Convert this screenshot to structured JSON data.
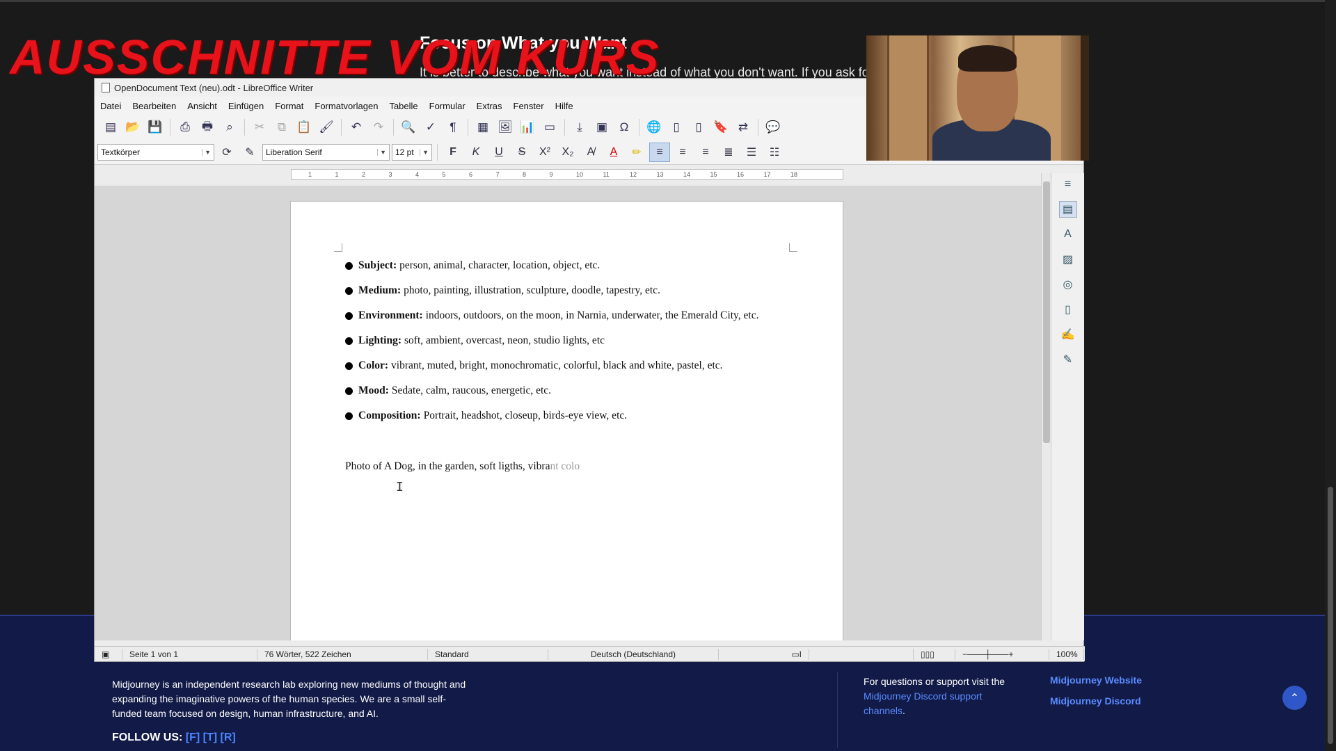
{
  "background_page": {
    "heading": "Focus on What you Want",
    "subtext": "It is better to describe what you want instead of what you don't want. If you ask for a pa"
  },
  "overlay": {
    "banner": "AUSSCHNITTE VOM KURS"
  },
  "writer": {
    "title": "OpenDocument Text (neu).odt - LibreOffice Writer",
    "menu": [
      "Datei",
      "Bearbeiten",
      "Ansicht",
      "Einfügen",
      "Format",
      "Formatvorlagen",
      "Tabelle",
      "Formular",
      "Extras",
      "Fenster",
      "Hilfe"
    ],
    "paragraph_style": "Textkörper",
    "font_name": "Liberation Serif",
    "font_size": "12 pt",
    "ruler_numbers": [
      "1",
      "1",
      "2",
      "3",
      "4",
      "5",
      "6",
      "7",
      "8",
      "9",
      "10",
      "11",
      "12",
      "13",
      "14",
      "15",
      "16",
      "17",
      "18"
    ],
    "bullets": [
      {
        "label": "Subject:",
        "text": "person, animal, character, location, object, etc."
      },
      {
        "label": "Medium:",
        "text": "photo, painting, illustration, sculpture, doodle, tapestry, etc."
      },
      {
        "label": "Environment:",
        "text": "indoors, outdoors, on the moon, in Narnia, underwater, the Emerald City, etc."
      },
      {
        "label": "Lighting:",
        "text": "soft, ambient, overcast, neon, studio lights, etc"
      },
      {
        "label": "Color:",
        "text": "vibrant, muted, bright, monochromatic, colorful, black and white, pastel, etc."
      },
      {
        "label": "Mood:",
        "text": "Sedate, calm, raucous, energetic, etc."
      },
      {
        "label": "Composition:",
        "text": "Portrait, headshot, closeup, birds-eye view, etc."
      }
    ],
    "prompt_typed": "Photo of A Dog, in the garden, soft ligths, vibra",
    "prompt_suggestion": "nt colo",
    "status": {
      "page": "Seite 1 von 1",
      "words": "76 Wörter, 522 Zeichen",
      "page_style": "Standard",
      "language": "Deutsch (Deutschland)",
      "zoom": "100%"
    }
  },
  "footer": {
    "about": "Midjourney is an independent research lab exploring new mediums of thought and expanding the imaginative powers of the human species. We are a small self-funded team focused on design, human infrastructure, and AI.",
    "follow_label": "FOLLOW US:",
    "follow_links": "[F] [T] [R]",
    "support_prefix": "For questions or support visit the",
    "support_link": "Midjourney Discord support channels",
    "support_suffix": ".",
    "link_website": "Midjourney Website",
    "link_discord": "Midjourney Discord",
    "top_icon": "chevron-up-icon"
  }
}
